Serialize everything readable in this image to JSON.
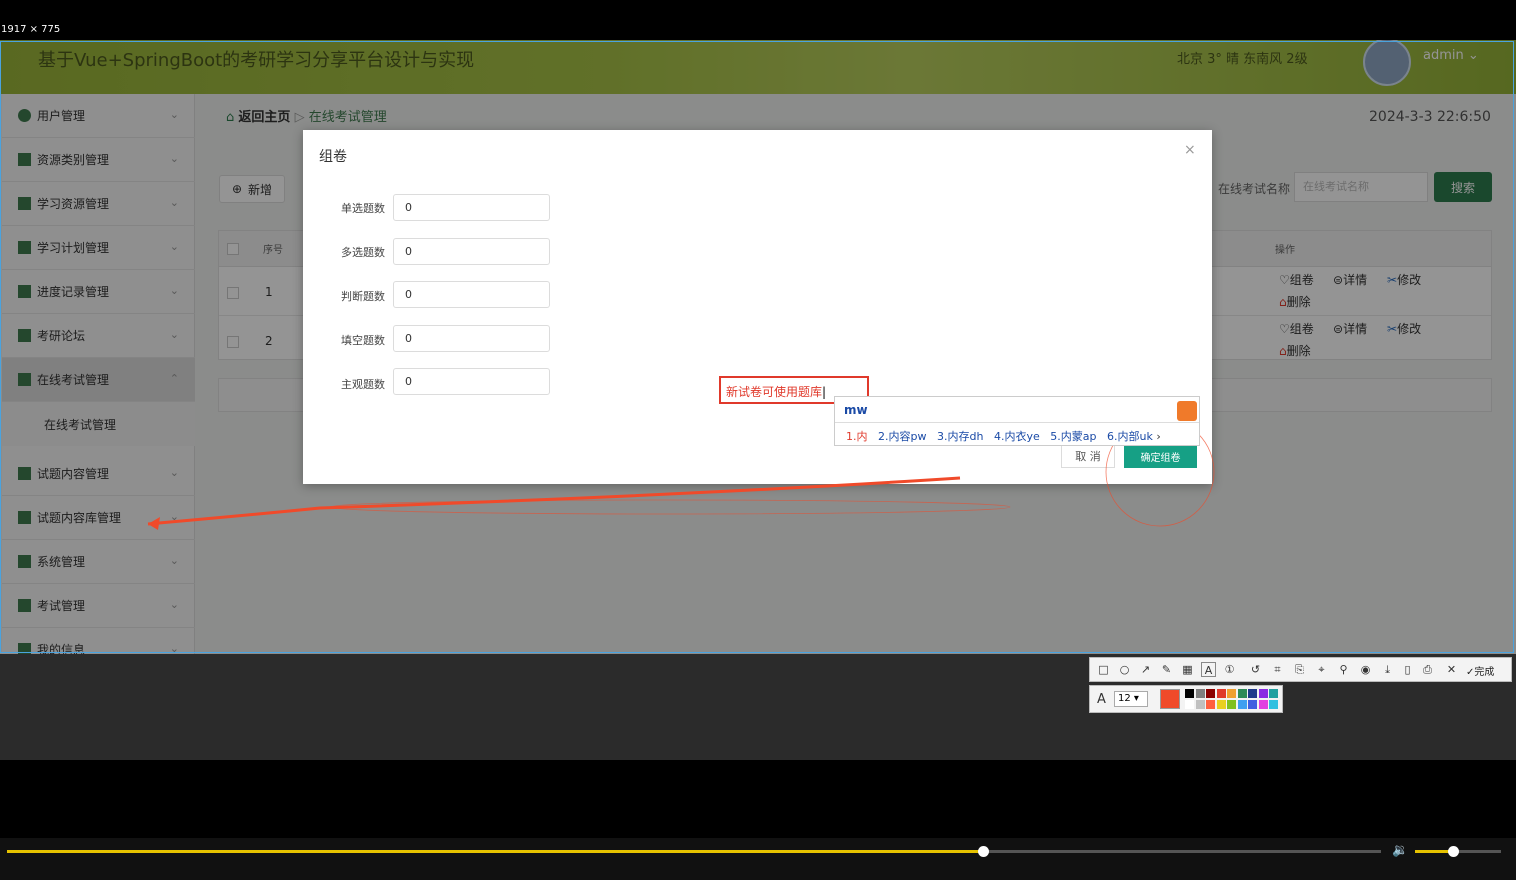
{
  "screen_dims": "1917 × 775",
  "header": {
    "title": "基于Vue+SpringBoot的考研学习分享平台设计与实现",
    "weather": "北京  3°  晴  东南风  2级",
    "user": "admin ⌄"
  },
  "sidebar": {
    "items": [
      {
        "label": "用户管理"
      },
      {
        "label": "资源类别管理"
      },
      {
        "label": "学习资源管理"
      },
      {
        "label": "学习计划管理"
      },
      {
        "label": "进度记录管理"
      },
      {
        "label": "考研论坛"
      },
      {
        "label": "在线考试管理"
      },
      {
        "label": "试题内容管理"
      },
      {
        "label": "试题内容库管理"
      },
      {
        "label": "系统管理"
      },
      {
        "label": "考试管理"
      },
      {
        "label": "我的信息"
      }
    ],
    "sub_item": "在线考试管理"
  },
  "breadcrumb": {
    "home": "返回主页",
    "sep": "▷",
    "current": "在线考试管理"
  },
  "datetime": "2024-3-3 22:6:50",
  "toolbar": {
    "add_label": "新增",
    "search_label": "在线考试名称",
    "search_placeholder": "在线考试名称",
    "search_button": "搜索"
  },
  "table": {
    "headers": {
      "check": "",
      "index": "序号",
      "ops": "操作"
    },
    "rows": [
      {
        "index": "1",
        "ops": [
          "组卷",
          "详情",
          "修改",
          "删除"
        ]
      },
      {
        "index": "2",
        "ops": [
          "组卷",
          "详情",
          "修改",
          "删除"
        ]
      }
    ]
  },
  "dialog": {
    "title": "组卷",
    "close": "×",
    "fields": [
      {
        "label": "单选题数",
        "value": "0"
      },
      {
        "label": "多选题数",
        "value": "0"
      },
      {
        "label": "判断题数",
        "value": "0"
      },
      {
        "label": "填空题数",
        "value": "0"
      },
      {
        "label": "主观题数",
        "value": "0"
      }
    ],
    "cancel": "取 消",
    "confirm": "确定组卷"
  },
  "annotation": {
    "text": "新试卷可使用题库"
  },
  "ime": {
    "composition": "mw",
    "candidates": [
      {
        "n": "1.",
        "text": "内"
      },
      {
        "n": "2.",
        "text": "内容pw"
      },
      {
        "n": "3.",
        "text": "内存dh"
      },
      {
        "n": "4.",
        "text": "内衣ye"
      },
      {
        "n": "5.",
        "text": "内蒙ap"
      },
      {
        "n": "6.",
        "text": "内部uk"
      }
    ]
  },
  "annotation_toolbar": {
    "done_label": "完成",
    "font_size": "12",
    "current_color": "#f04a2a",
    "palette": [
      "#000000",
      "#808080",
      "#8b0000",
      "#e0392b",
      "#f0a030",
      "#2e8b57",
      "#1e3a8a",
      "#8a2be2",
      "#20a0a0",
      "#ffffff",
      "#c0c0c0",
      "#ff6040",
      "#e8d020",
      "#80c020",
      "#40a0f0",
      "#4060e0",
      "#e040e0",
      "#30c0e0"
    ]
  },
  "player": {
    "progress": 0.71,
    "volume": 0.44
  }
}
